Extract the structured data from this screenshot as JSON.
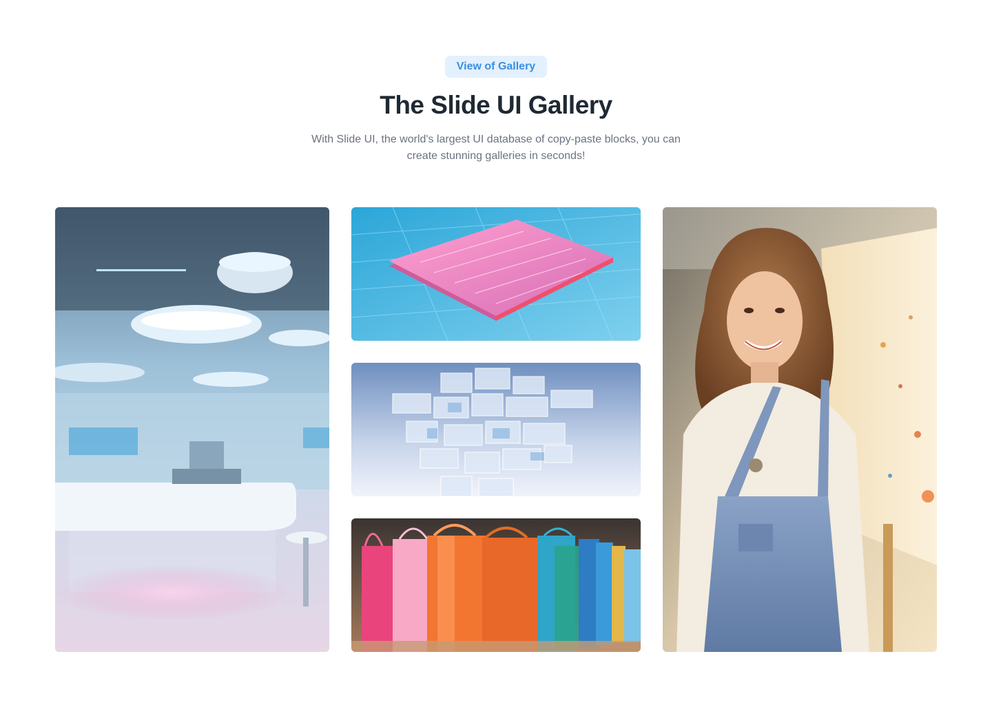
{
  "section": {
    "badge_label": "View of Gallery",
    "title": "The Slide UI Gallery",
    "description": "With Slide UI, the world's largest UI database of copy-paste blocks, you can create stunning galleries in seconds!"
  },
  "gallery": {
    "images": [
      {
        "subject": "futuristic-lab-interior"
      },
      {
        "subject": "microchip-circuit"
      },
      {
        "subject": "glass-cubes-structure"
      },
      {
        "subject": "colorful-shopping-bags"
      },
      {
        "subject": "smiling-painter-woman"
      }
    ]
  },
  "colors": {
    "accent": "#3a8fe0",
    "badge_bg": "#e3f0fd",
    "title": "#1f2933",
    "body_text": "#6b7280"
  }
}
